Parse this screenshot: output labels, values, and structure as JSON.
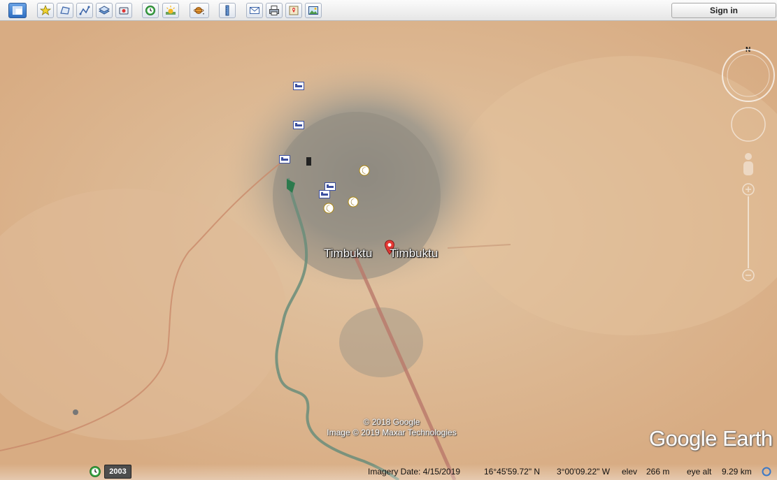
{
  "toolbar": {
    "sign_in_label": "Sign in",
    "buttons": [
      {
        "name": "sidebar-toggle-button",
        "icon": "sidebar-icon"
      },
      {
        "name": "add-placemark-button",
        "icon": "placemark-icon"
      },
      {
        "name": "add-polygon-button",
        "icon": "polygon-icon"
      },
      {
        "name": "add-path-button",
        "icon": "path-icon"
      },
      {
        "name": "add-image-overlay-button",
        "icon": "overlay-icon"
      },
      {
        "name": "record-tour-button",
        "icon": "record-tour-icon"
      },
      {
        "name": "historical-imagery-button",
        "icon": "clock-icon"
      },
      {
        "name": "sunlight-button",
        "icon": "sun-icon"
      },
      {
        "name": "planets-button",
        "icon": "planet-icon"
      },
      {
        "name": "ruler-button",
        "icon": "ruler-icon"
      },
      {
        "name": "email-button",
        "icon": "email-icon"
      },
      {
        "name": "print-button",
        "icon": "print-icon"
      },
      {
        "name": "view-in-maps-button",
        "icon": "maps-icon"
      },
      {
        "name": "save-image-button",
        "icon": "save-image-icon"
      }
    ]
  },
  "map": {
    "place_labels": [
      "Timbuktu",
      "Timbuktu"
    ],
    "copyright_line1": "© 2018 Google",
    "copyright_line2": "Image © 2019 Maxar Technologies",
    "logo_text": "Google Earth",
    "compass_north": "N",
    "colors": {
      "desert": "#dcb58f",
      "town": "#9a9589",
      "river": "#6a8d7a",
      "road": "#c98a6a",
      "pin": "#e53935",
      "mosque": "#e8c33a"
    }
  },
  "status": {
    "year": "2003",
    "imagery_date": "Imagery Date: 4/15/2019",
    "latitude": "16°45'59.72\" N",
    "longitude": "3°00'09.22\" W",
    "elev_label": "elev",
    "elev_value": "266 m",
    "eye_alt_label": "eye alt",
    "eye_alt_value": "9.29 km"
  }
}
